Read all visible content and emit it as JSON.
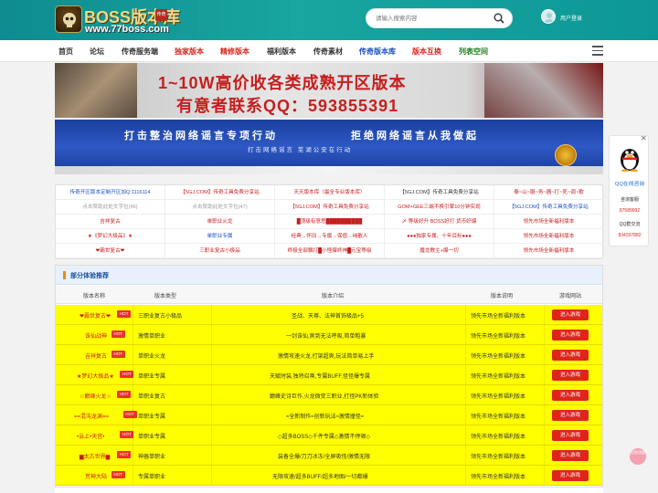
{
  "header": {
    "logo_text": "BOSS版本库",
    "logo_url": "www.77boss.com",
    "logo_badge": "传奇",
    "search_placeholder": "请输入搜索内容",
    "user_label": "用户登录"
  },
  "nav": {
    "items": [
      "首页",
      "论坛",
      "传奇服务端",
      "独家版本",
      "精修版本",
      "福利版本",
      "传奇素材",
      "传奇版本库",
      "版本互换",
      "列表空间"
    ],
    "colors": [
      "#333333",
      "#333333",
      "#333333",
      "#d6281e",
      "#d6281e",
      "#333333",
      "#333333",
      "#1a4fc4",
      "#d6281e",
      "#1a7a1a"
    ]
  },
  "banner1": {
    "line1": "1~10W高价收各类成熟开区版本",
    "line2": "有意者联系QQ：593855391"
  },
  "banner2": {
    "left": "打击整治网络谣言专项行动",
    "right": "拒绝网络谣言从我做起",
    "sub": "打击网络谣言  芜湖公安在行动"
  },
  "links": {
    "rows": [
      [
        "传奇开区版本定制开区加Q:1116114",
        "【5GJ.COM】传奇工具免费分享站",
        "天天版本库（最全专业版本库）",
        "【5GJ.COM】传奇工具免费分享站",
        "泰~山~服~务~器~打~死~调~歌"
      ],
      [
        "点击赞助此处文字位(46)",
        "点击赞助此处文字位(47)",
        "【5GJ.COM】传奇工具免费分享站",
        "GOM+GEE三端不换引擎10分钟实现",
        "【5GJ.COM】传奇工具免费分享站"
      ],
      [
        "吉祥复古",
        "单职业火龙",
        "█顶级有意思██████████",
        "〆 等级好升 BOSS好打 货币好爆",
        "领先市场全新福利版本"
      ],
      [
        "★《梦幻大极品》★",
        "单职业专属",
        "经典→怀旧→专属→保值→纯散人",
        "●●●独家专属、十年目标●●●",
        "领先市场全新福利版本"
      ],
      [
        "❤霸世复古❤",
        "三职业复古小极品",
        "终极全部飘打█小怪爆终神█元宝等级",
        "魔龙教主+爆一切",
        "领先市场全新福利版本"
      ]
    ],
    "colors": [
      [
        "#1a4fc4",
        "#c81e1e",
        "#c81e1e",
        "#333333",
        "#c81e1e"
      ],
      [
        "#999999",
        "#999999",
        "#c81e1e",
        "#c81e1e",
        "#1a4fc4"
      ],
      [
        "#c81e1e",
        "#c81e1e",
        "#c81e1e",
        "#c81e1e",
        "#c81e1e"
      ],
      [
        "#c81e1e",
        "#1a4fc4",
        "#c81e1e",
        "#c81e1e",
        "#c81e1e"
      ],
      [
        "#c81e1e",
        "#c81e1e",
        "#c81e1e",
        "#c81e1e",
        "#c81e1e"
      ]
    ]
  },
  "section": {
    "title": "部分体验推荐",
    "headers": [
      "版本名称",
      "版本类型",
      "版本介绍",
      "版本说明",
      "游戏网站"
    ],
    "play_label": "进入游戏",
    "hot_label": "HOT",
    "rows": [
      [
        "❤霸世复古❤",
        "三职业复古小极品",
        "圣战、天尊、法神首饰极品+5",
        "领先市场全新福利版本"
      ],
      [
        "诛仙战神",
        "激情单职业",
        "一剑诛仙,爽到无法呼吸,简单粗暴",
        "领先市场全新福利版本"
      ],
      [
        "吉祥复古",
        "单职业火龙",
        "激情攻速火龙,打架超爽,玩法简单易上手",
        "领先市场全新福利版本"
      ],
      [
        "★梦幻大极品★",
        "单职业专属",
        "天赋时装,独特召唤,专属BUFF,怪怪爆专属",
        "领先市场全新福利版本"
      ],
      [
        "☆巅峰火龙☆",
        "单职业复古",
        "巅峰史诗巨作,火龙微变三职业,打怪PK新体验",
        "领先市场全新福利版本"
      ],
      [
        "==混沌龙渊==",
        "单职业专属",
        "≈全新制作≈创新玩法≈激情撞怪≈",
        "领先市场全新福利版本"
      ],
      [
        "•云上•天宫•",
        "单职业专属",
        "◇超多BOSS◇千件专属◇激情不停顿◇",
        "领先市场全新福利版本"
      ],
      [
        "▆太古世界▆",
        "神器单职业",
        "装备全爆/刀刀冰冻/全屏吸怪/激情无限",
        "领先市场全新福利版本"
      ],
      [
        "荒神大陆",
        "专属单职业",
        "无限攻速/超多BUFF/超多地图/一切都爆",
        "领先市场全新福利版本"
      ]
    ]
  },
  "widget": {
    "title": "QQ在线咨询",
    "l1": "咨询客服",
    "l2": "87589992",
    "l3": "QQ群交流",
    "l4": "834337882"
  },
  "fab_label": "回到顶部"
}
